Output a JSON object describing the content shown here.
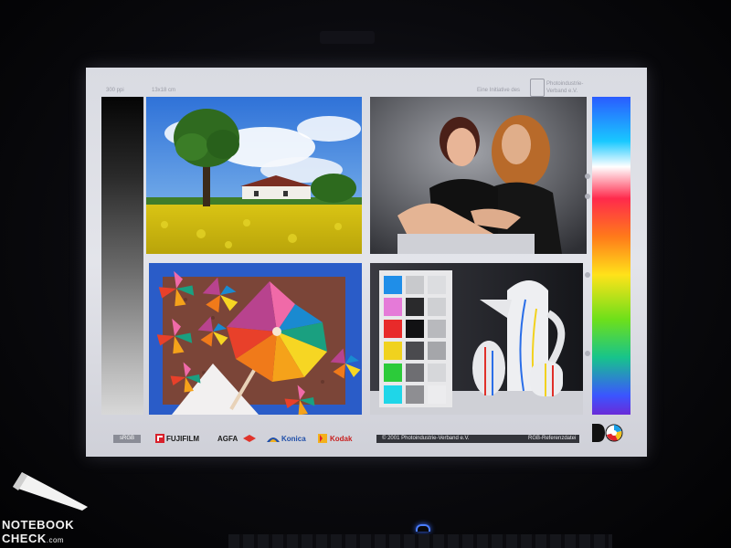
{
  "screen": {
    "header": {
      "resolution": "300 ppi",
      "print_size": "13x18 cm",
      "initiative": "Eine Initiative des",
      "org_name": "Photoindustrie-Verband e.V."
    },
    "photos": [
      {
        "name": "landscape",
        "subject": "tree, clouds and yellow rapeseed field"
      },
      {
        "name": "portrait",
        "subject": "two women posing"
      },
      {
        "name": "pinwheel",
        "subject": "colorful paper pinwheels"
      },
      {
        "name": "still-life",
        "subject": "color patch chart and white ceramic jugs"
      }
    ],
    "footer": {
      "color_space": "sRGB",
      "brands": [
        "FUJIFILM",
        "AGFA",
        "Konica",
        "Kodak"
      ],
      "copyright": "© 2001 Photoindustrie-Verband e.V.",
      "file_label": "RGB-Referenzdatei"
    }
  },
  "watermark": {
    "line1": "NOTEBOOK",
    "line2": "CHECK",
    "suffix": ".com"
  },
  "colors": {
    "bezel": "#050507",
    "screen_bg": "#dcdde3",
    "fuji_red": "#d8202b",
    "agfa_red": "#e0332a",
    "konica_blue": "#1f4ea8",
    "kodak_yellow": "#f3b11b",
    "kodak_red": "#e0232b",
    "led_blue": "#4a7dff"
  },
  "icons": [
    "fujifilm-logo-icon",
    "agfa-logo-icon",
    "konica-logo-icon",
    "kodak-logo-icon",
    "do-logo-icon",
    "pen-icon"
  ]
}
